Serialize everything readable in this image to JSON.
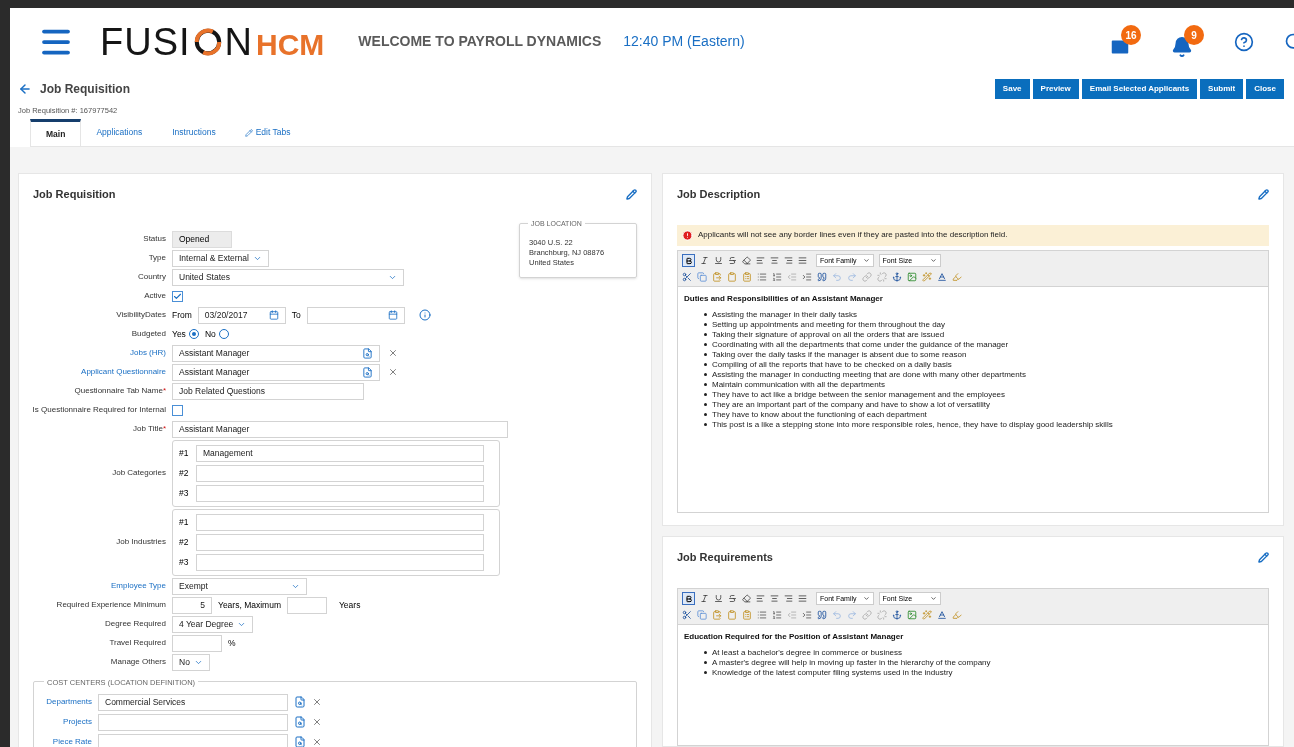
{
  "header": {
    "brand": {
      "before": "FUSI",
      "after": "N",
      "accent": "HCM"
    },
    "welcome": "WELCOME TO PAYROLL DYNAMICS",
    "time": "12:40 PM (Eastern)",
    "mail_count": "16",
    "alert_count": "9"
  },
  "page": {
    "title": "Job Requisition",
    "number": "Job Requisition #: 167977542",
    "actions": [
      "Save",
      "Preview",
      "Email Selected Applicants",
      "Submit",
      "Close"
    ],
    "tabs": [
      {
        "label": "Main",
        "selected": true
      },
      {
        "label": "Applications",
        "selected": false
      },
      {
        "label": "Instructions",
        "selected": false
      }
    ],
    "edit_tabs": "Edit Tabs"
  },
  "requisition": {
    "title": "Job Requisition",
    "rows": [
      {
        "kind": "readonly",
        "label": "Status",
        "value": "Opened"
      },
      {
        "kind": "select",
        "label": "Type",
        "value": "Internal & External"
      },
      {
        "kind": "select_wide",
        "label": "Country",
        "value": "United States"
      },
      {
        "kind": "checkbox",
        "label": "Active",
        "checked": true
      },
      {
        "kind": "daterange",
        "label": "VisibilityDates",
        "from_label": "From",
        "from": "03/20/2017",
        "to_label": "To"
      },
      {
        "kind": "radio",
        "label": "Budgeted",
        "options": [
          {
            "label": "Yes",
            "selected": true
          },
          {
            "label": "No",
            "selected": false
          }
        ]
      },
      {
        "kind": "lookup",
        "label": "Jobs (HR)",
        "link": true,
        "value": "Assistant Manager"
      },
      {
        "kind": "lookup",
        "label": "Applicant Questionnaire",
        "link": true,
        "value": "Assistant Manager"
      },
      {
        "kind": "text",
        "label": "Questionnaire Tab Name",
        "required_mark": "*",
        "value": "Job Related Questions"
      },
      {
        "kind": "checkbox",
        "label": "Is Questionnaire Required for Internal",
        "checked": false
      },
      {
        "kind": "text_wide",
        "label": "Job Title",
        "required_mark": "*",
        "value": "Assistant Manager"
      },
      {
        "kind": "group",
        "label": "Job Categories",
        "items": [
          {
            "number": "#1",
            "value": "Management"
          },
          {
            "number": "#2"
          },
          {
            "number": "#3"
          }
        ]
      },
      {
        "kind": "group",
        "label": "Job Industries",
        "items": [
          {
            "number": "#1"
          },
          {
            "number": "#2"
          },
          {
            "number": "#3"
          }
        ]
      },
      {
        "kind": "select_medium",
        "label": "Employee Type",
        "link": true,
        "value": "Exempt"
      },
      {
        "kind": "range",
        "label": "Required Experience Minimum",
        "value": "5",
        "middle": "Years, Maximum",
        "suffix": "Years"
      },
      {
        "kind": "select",
        "label": "Degree Required",
        "value": "4 Year Degree"
      },
      {
        "kind": "suffix",
        "label": "Travel Required",
        "suffix": "%"
      },
      {
        "kind": "select",
        "label": "Manage Others",
        "value": "No"
      }
    ],
    "location": {
      "legend": "JOB LOCATION",
      "lines": [
        "3040 U.S. 22",
        "Branchburg, NJ 08876",
        "United States"
      ]
    },
    "cost_centers": {
      "legend": "COST CENTERS (LOCATION DEFINITION)",
      "rows": [
        {
          "label": "Departments",
          "value": "Commercial Services"
        },
        {
          "label": "Projects"
        },
        {
          "label": "Piece Rate"
        }
      ]
    }
  },
  "description": {
    "title": "Job Description",
    "notice": "Applicants will not see any border lines even if they are pasted into the description field.",
    "editor": {
      "bold": true,
      "font_family": "Font Family",
      "font_size": "Font Size",
      "heading": "Duties and Responsibilities of an Assistant Manager",
      "items": [
        "Assisting the manager in their daily tasks",
        "Setting up appointments and meeting for them throughout the day",
        "Taking their signature of approval on all the orders that are issued",
        "Coordinating with all the departments that come under the guidance of the manager",
        "Taking over the daily tasks if the manager is absent due to some reason",
        "Compiling of all the reports that have to be checked on a daily basis",
        "Assisting the manager in conducting meeting that are done with many other departments",
        "Maintain communication with all the departments",
        "They have to act like a bridge between the senior management and the employees",
        "They are an important part of the company and have to show a lot of versatility",
        "They have to know about the functioning of each department",
        "This post is a like a stepping stone into more responsible roles, hence, they have to display good leadership skills"
      ]
    }
  },
  "requirements": {
    "title": "Job Requirements",
    "editor": {
      "bold": true,
      "font_family": "Font Family",
      "font_size": "Font Size",
      "heading": "Education Required for the Position of Assistant Manager",
      "items": [
        "At least a  bachelor's degree in commerce or business",
        "A master's degree will help in moving up faster in the hierarchy of the company",
        "Knowledge of the latest computer filing systems used in the industry"
      ]
    }
  }
}
